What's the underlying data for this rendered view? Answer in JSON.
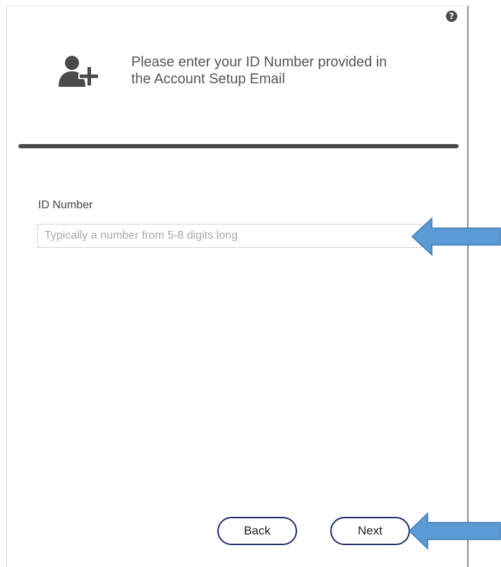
{
  "header": {
    "help_icon_glyph": "?",
    "icon": "user-plus-icon",
    "text_line1": "Please enter your ID Number provided in",
    "text_line2": "the Account Setup Email"
  },
  "form": {
    "id_label": "ID Number",
    "id_value": "",
    "id_placeholder": "Typically a number from 5-8 digits long"
  },
  "buttons": {
    "back_label": "Back",
    "next_label": "Next"
  },
  "annotations": {
    "arrow_color": "#5b9bd5",
    "arrow_outline": "#3f7bb8",
    "input_arrow_icon": "left-arrow-icon",
    "next_arrow_icon": "left-arrow-icon"
  },
  "colors": {
    "button_border": "#1f2d6b",
    "divider": "#4a4a4a",
    "text": "#555555"
  }
}
